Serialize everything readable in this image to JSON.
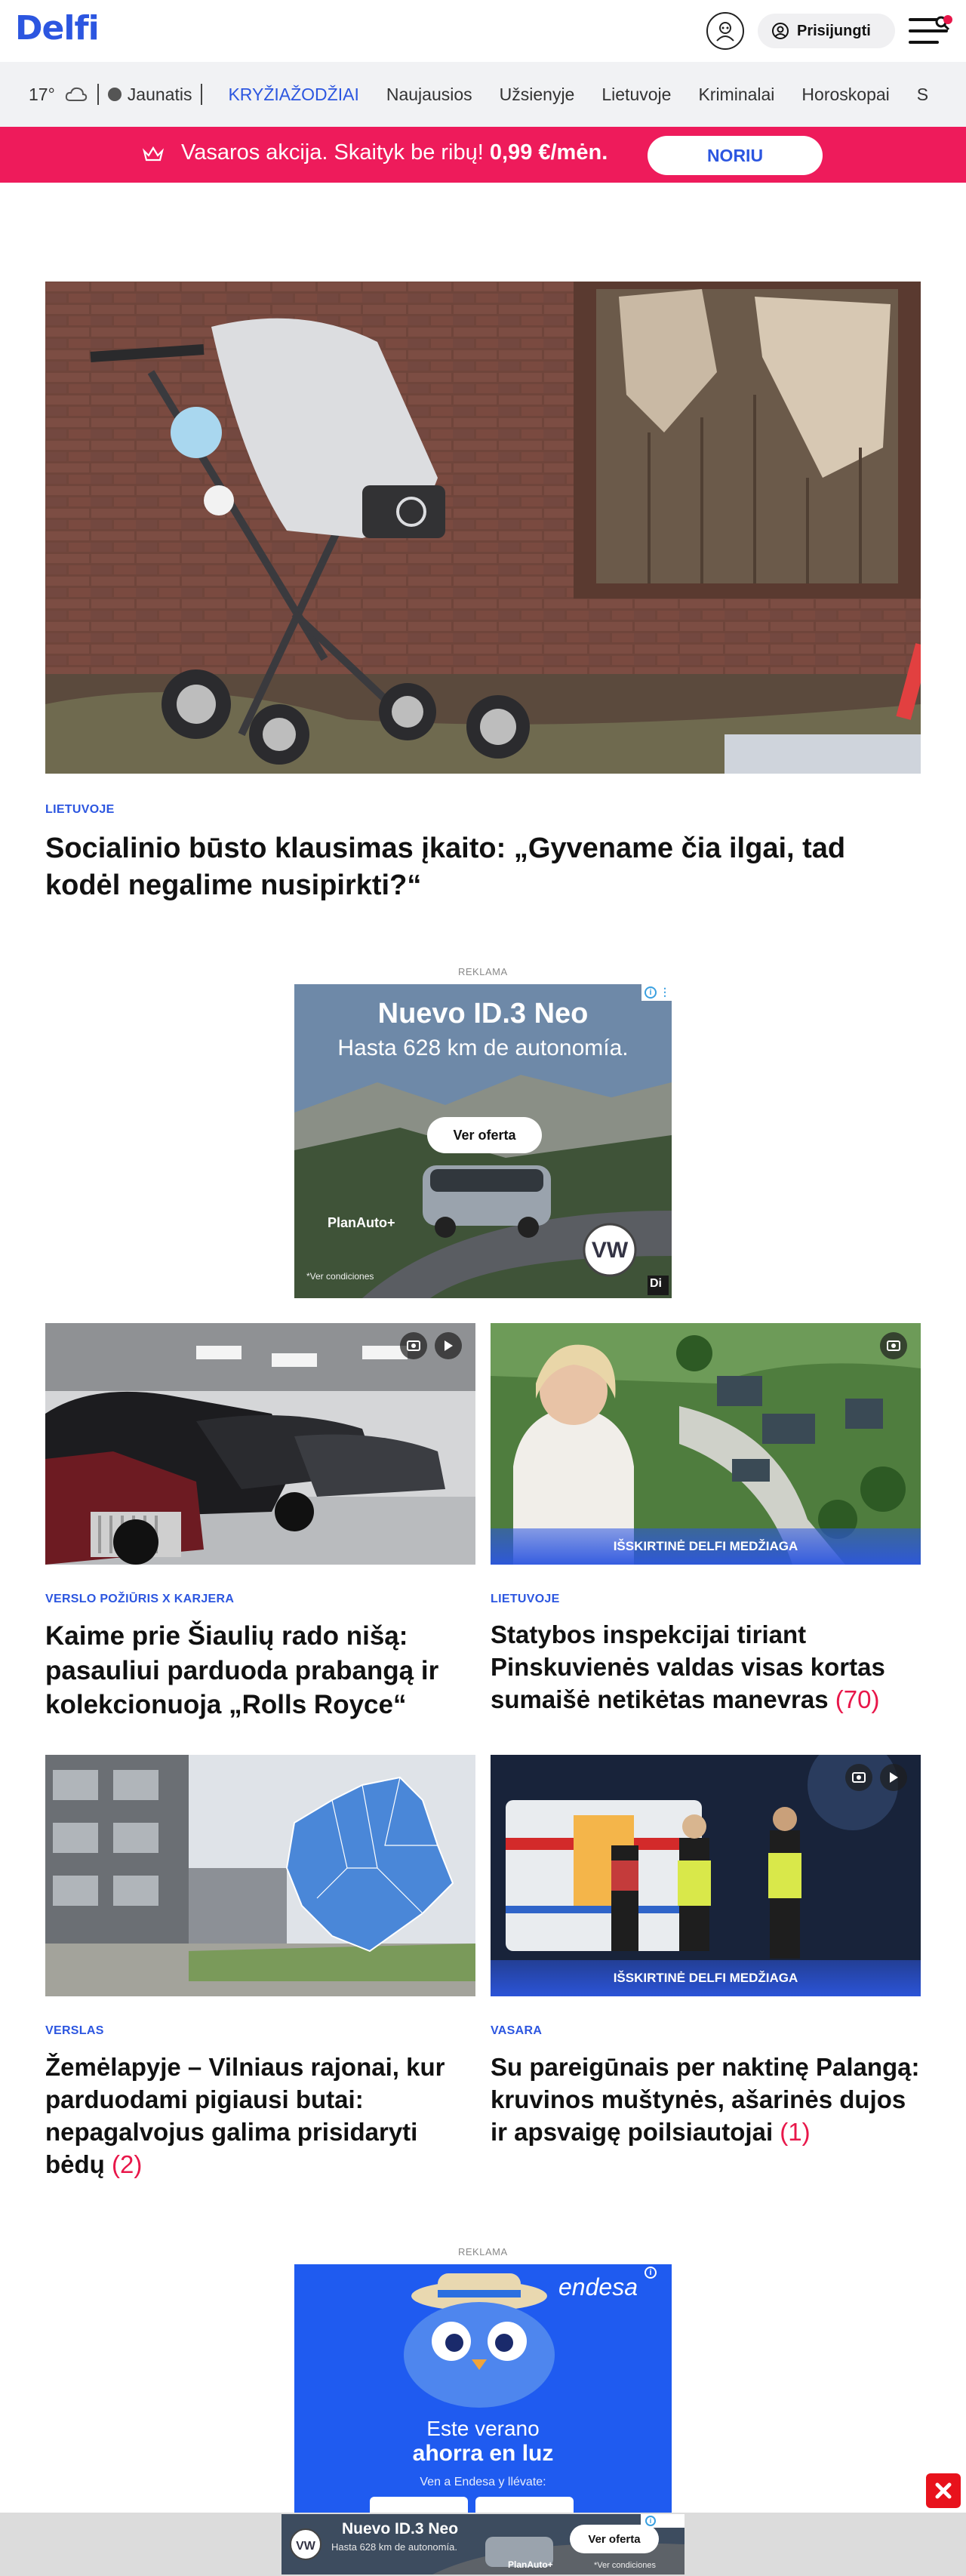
{
  "header": {
    "logo": "Delfi",
    "login_label": "Prisijungti"
  },
  "nav": {
    "temperature": "17°",
    "name": "Jaunatis",
    "items": [
      "KRYŽIAŽODŽIAI",
      "Naujausios",
      "Užsienyje",
      "Lietuvoje",
      "Kriminalai",
      "Horoskopai",
      "S"
    ]
  },
  "promo": {
    "text": "Vasaros akcija. Skaityk be ribų!",
    "price": "0,99 €/mėn.",
    "button": "NORIU"
  },
  "hero": {
    "kicker": "LIETUVOJE",
    "title": "Socialinio būsto klausimas įkaito: „Gyvename čia ilgai, tad kodėl negalime nusipirkti?“"
  },
  "ad1": {
    "label": "REKLAMA",
    "headline": "Nuevo ID.3 Neo",
    "subline": "Hasta 628 km de autonomía.",
    "cta": "Ver oferta",
    "brand": "PlanAuto+",
    "disclaimer": "*Ver condiciones",
    "corner": "Di"
  },
  "articles": [
    {
      "kicker": "VERSLO POŽIŪRIS X KARJERA",
      "title": "Kaime prie Šiaulių rado nišą: pasauliui parduoda prabangą ir kolekcionuoja „Rolls Royce“",
      "count": "",
      "badge": ""
    },
    {
      "kicker": "LIETUVOJE",
      "title": "Statybos inspekcijai tiriant Pinskuvienės valdas visas kortas sumaišė netikėtas manevras",
      "count": "(70)",
      "badge": "IŠSKIRTINĖ DELFI MEDŽIAGA"
    },
    {
      "kicker": "VERSLAS",
      "title": "Žemėlapyje – Vilniaus rajonai, kur parduodami pigiausi butai: nepagalvojus galima prisidaryti bėdų",
      "count": "(2)",
      "badge": ""
    },
    {
      "kicker": "VASARA",
      "title": "Su pareigūnais per naktinę Palangą: kruvinos muštynės, ašarinės dujos ir apsvaigę poilsiautojai",
      "count": "(1)",
      "badge": "IŠSKIRTINĖ DELFI MEDŽIAGA"
    }
  ],
  "ad2": {
    "label": "REKLAMA",
    "brand": "endesa",
    "line1": "Este verano",
    "line2": "ahorra en luz",
    "line3": "Ven a Endesa y llévate:"
  },
  "bottom_ad": {
    "headline": "Nuevo ID.3 Neo",
    "subline": "Hasta 628 km de autonomía.",
    "cta": "Ver oferta",
    "brand": "PlanAuto+",
    "disclaimer": "*Ver condiciones"
  },
  "colors": {
    "brand_blue": "#2c56e0",
    "promo_pink": "#ee1b5b",
    "count_red": "#e8174a"
  }
}
